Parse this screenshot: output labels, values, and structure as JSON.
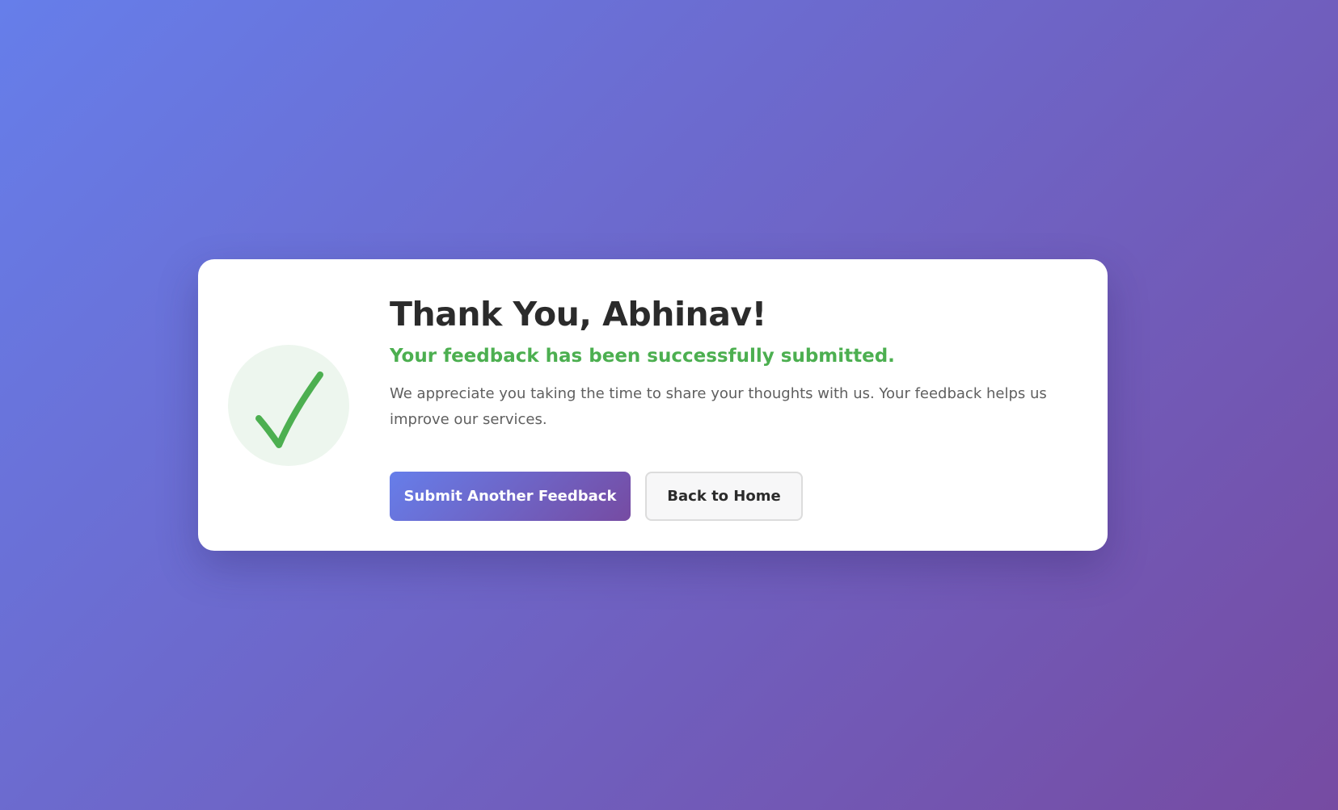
{
  "card": {
    "title": "Thank You, Abhinav!",
    "subtitle": "Your feedback has been successfully submitted.",
    "message": "We appreciate you taking the time to share your thoughts with us. Your feedback helps us improve our services.",
    "icon": "checkmark-icon"
  },
  "actions": {
    "primary_label": "Submit Another Feedback",
    "secondary_label": "Back to Home"
  },
  "colors": {
    "background_gradient_start": "#667eea",
    "background_gradient_end": "#764ba2",
    "success": "#4caf50",
    "success_bg": "#edf6ee"
  }
}
